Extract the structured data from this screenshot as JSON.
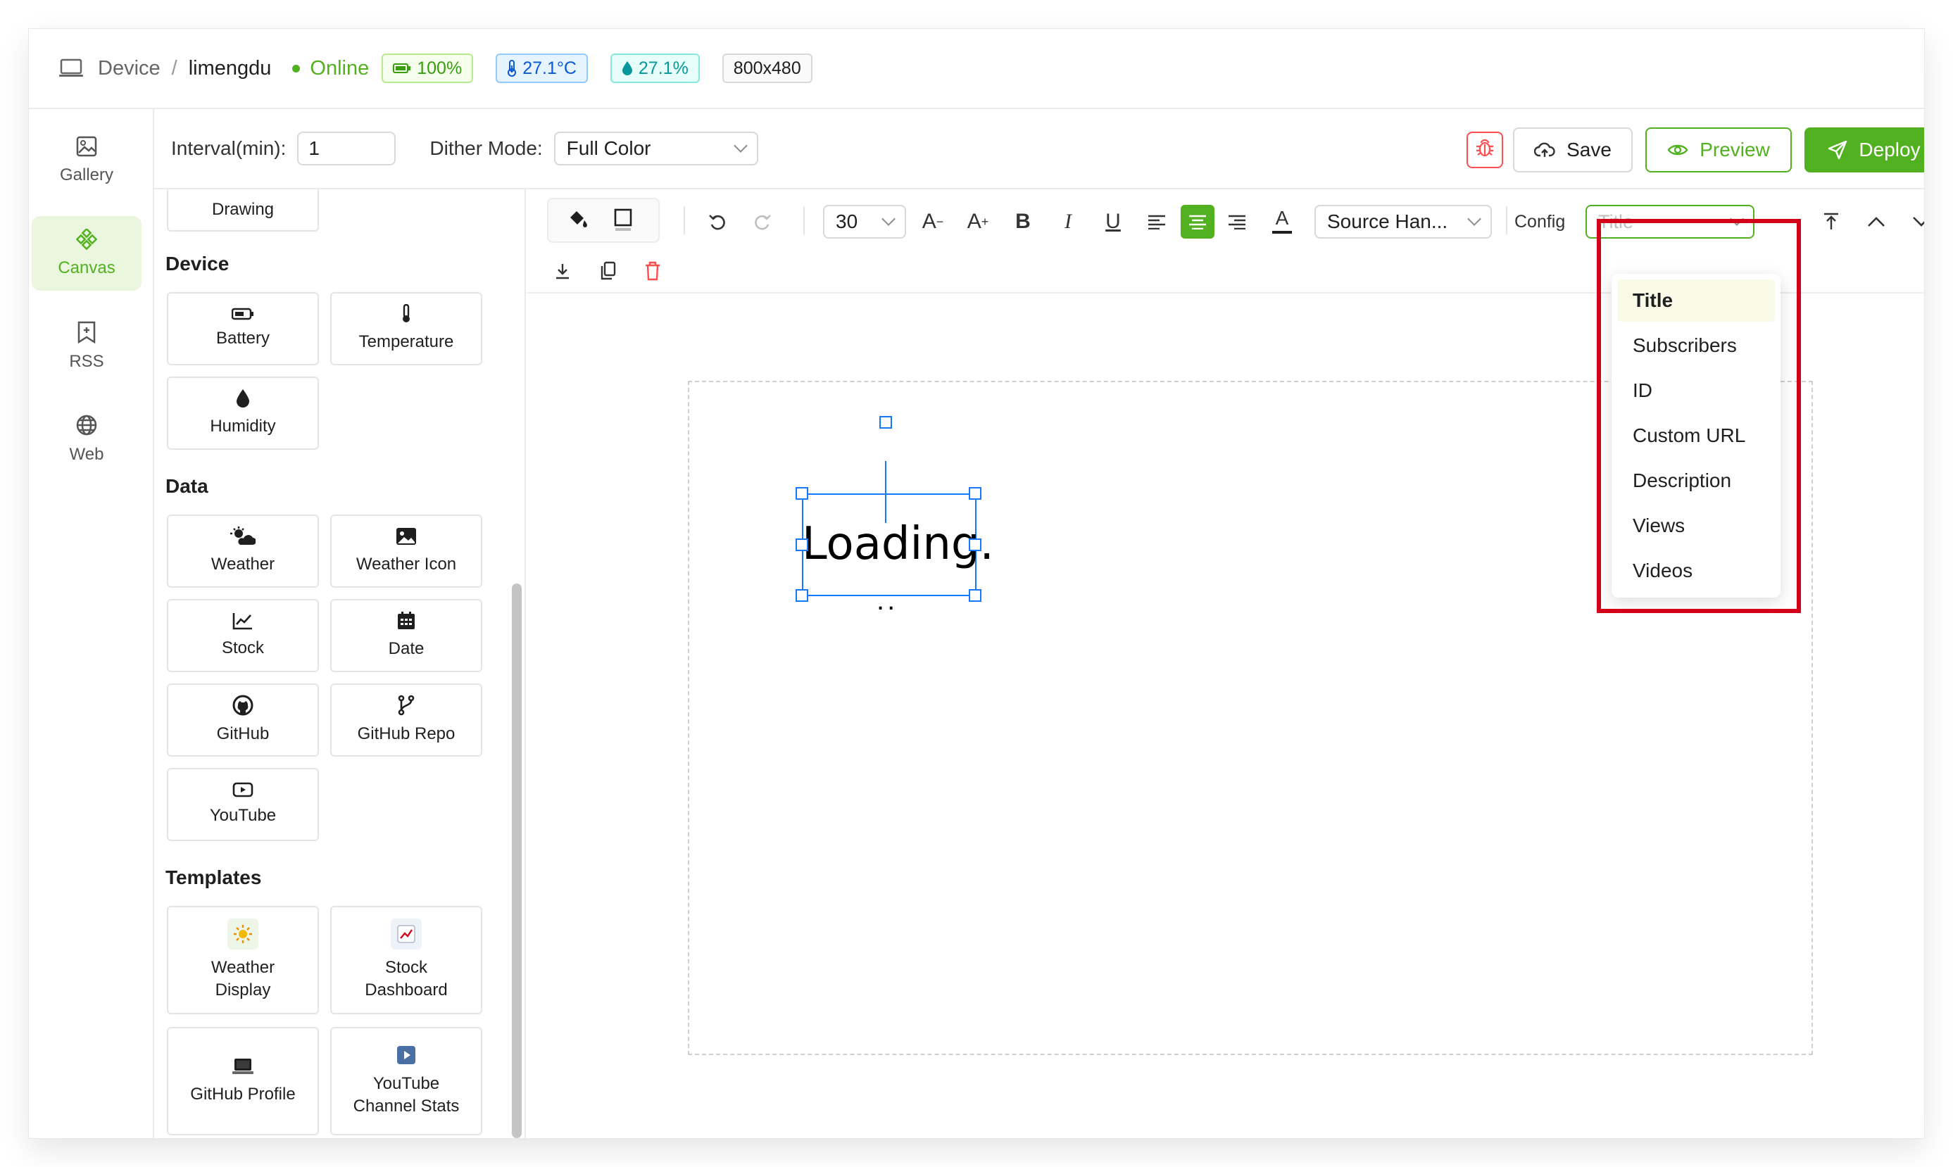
{
  "header": {
    "crumb": "Device",
    "separator": "/",
    "device_name": "limengdu",
    "status": "Online",
    "battery": "100%",
    "temperature": "27.1°C",
    "humidity": "27.1%",
    "resolution": "800x480"
  },
  "nav": {
    "items": [
      {
        "label": "Gallery",
        "icon": "image-icon"
      },
      {
        "label": "Canvas",
        "icon": "canvas-icon"
      },
      {
        "label": "RSS",
        "icon": "rss-icon"
      },
      {
        "label": "Web",
        "icon": "globe-icon"
      }
    ],
    "active": "Canvas"
  },
  "toolbar": {
    "interval_label": "Interval(min):",
    "interval_value": "1",
    "dither_label": "Dither Mode:",
    "dither_value": "Full Color",
    "save_label": "Save",
    "preview_label": "Preview",
    "deploy_label": "Deploy"
  },
  "palette": {
    "drawing_label": "Drawing",
    "device_title": "Device",
    "device_items": [
      "Battery",
      "Temperature",
      "Humidity"
    ],
    "data_title": "Data",
    "data_items": [
      "Weather",
      "Weather Icon",
      "Stock",
      "Date",
      "GitHub",
      "GitHub Repo",
      "YouTube"
    ],
    "templates_title": "Templates",
    "template_items": [
      "Weather Display",
      "Stock Dashboard",
      "GitHub Profile",
      "YouTube Channel Stats"
    ]
  },
  "editor": {
    "font_size": "30",
    "font_family": "Source Han...",
    "config_label": "Config",
    "config_placeholder": "Title",
    "config_options": [
      "Title",
      "Subscribers",
      "ID",
      "Custom URL",
      "Description",
      "Views",
      "Videos"
    ],
    "config_selected": "Title"
  },
  "canvas": {
    "text": "Loading.",
    "dots": ".."
  },
  "colors": {
    "accent": "#52b120",
    "selection": "#1677ff",
    "highlight": "#d4001a",
    "danger": "#ff4d4f"
  }
}
